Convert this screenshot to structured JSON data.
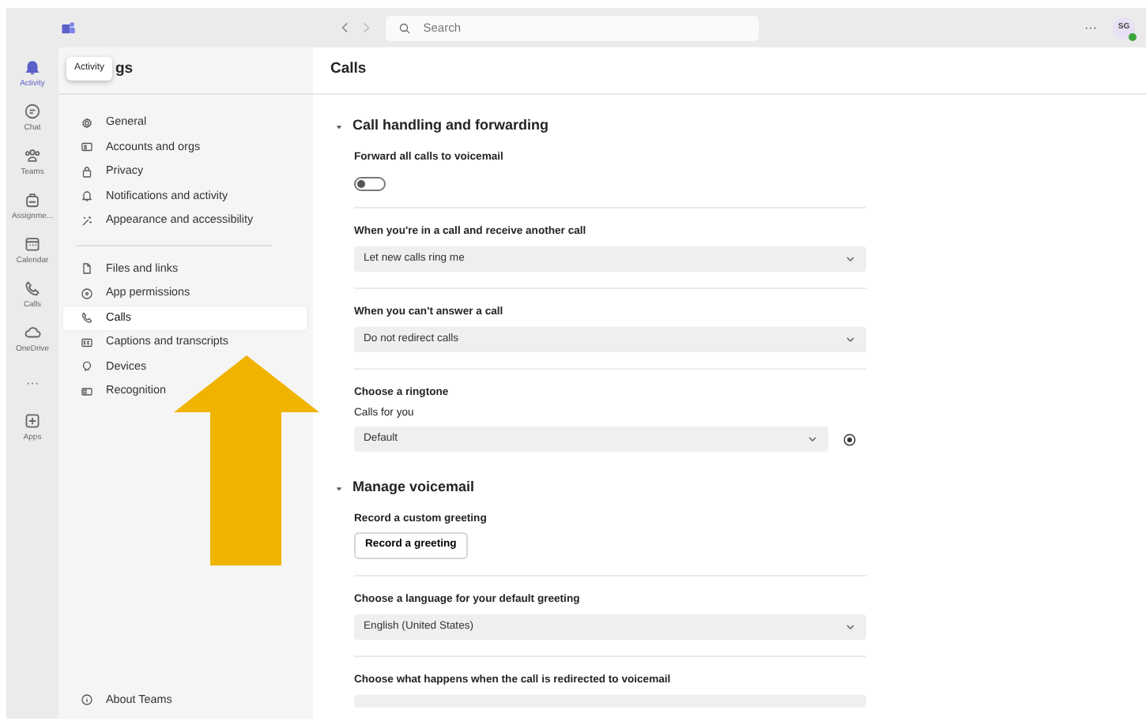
{
  "top_bar": {
    "search": {
      "placeholder": "Search"
    },
    "more": "···",
    "avatar": {
      "initials": "SG"
    }
  },
  "rail": [
    {
      "label": "Activity",
      "selected": true
    },
    {
      "label": "Chat",
      "selected": false
    },
    {
      "label": "Teams",
      "selected": false
    },
    {
      "label": "Assignme...",
      "selected": false
    },
    {
      "label": "Calendar",
      "selected": false
    },
    {
      "label": "Calls",
      "selected": false
    },
    {
      "label": "OneDrive",
      "selected": false
    },
    {
      "label": "···",
      "selected": false,
      "kind": "more"
    },
    {
      "label": "Apps",
      "selected": false
    }
  ],
  "tooltip": "Activity",
  "settings": {
    "title": "gs",
    "groups": [
      [
        {
          "label": "General",
          "selected": false
        },
        {
          "label": "Accounts and orgs",
          "selected": false
        },
        {
          "label": "Privacy",
          "selected": false
        },
        {
          "label": "Notifications and activity",
          "selected": false
        },
        {
          "label": "Appearance and accessibility",
          "selected": false
        }
      ],
      [
        {
          "label": "Files and links",
          "selected": false
        },
        {
          "label": "App permissions",
          "selected": false
        },
        {
          "label": "Calls",
          "selected": true
        },
        {
          "label": "Captions and transcripts",
          "selected": false
        },
        {
          "label": "Devices",
          "selected": false
        },
        {
          "label": "Recognition",
          "selected": false
        }
      ]
    ],
    "footer": "About Teams"
  },
  "page": {
    "title": "Calls",
    "sections": [
      {
        "title": "Call handling and forwarding",
        "expanded": true,
        "items": [
          {
            "kind": "toggle",
            "label": "Forward all calls to voicemail",
            "on": false
          },
          {
            "kind": "select",
            "label": "When you're in a call and receive another call",
            "value": "Let new calls ring me"
          },
          {
            "kind": "select",
            "label": "When you can't answer a call",
            "value": "Do not redirect calls"
          },
          {
            "kind": "select_play",
            "label": "Choose a ringtone",
            "sublabel": "Calls for you",
            "value": "Default"
          }
        ]
      },
      {
        "title": "Manage voicemail",
        "expanded": true,
        "items": [
          {
            "kind": "button",
            "label": "Record a custom greeting",
            "value": "Record a greeting"
          },
          {
            "kind": "select",
            "label": "Choose a language for your default greeting",
            "value": "English (United States)"
          },
          {
            "kind": "select",
            "label": "Choose what happens when the call is redirected to voicemail"
          }
        ]
      }
    ]
  },
  "annotation": {
    "kind": "arrow",
    "color": "#f0b400"
  }
}
